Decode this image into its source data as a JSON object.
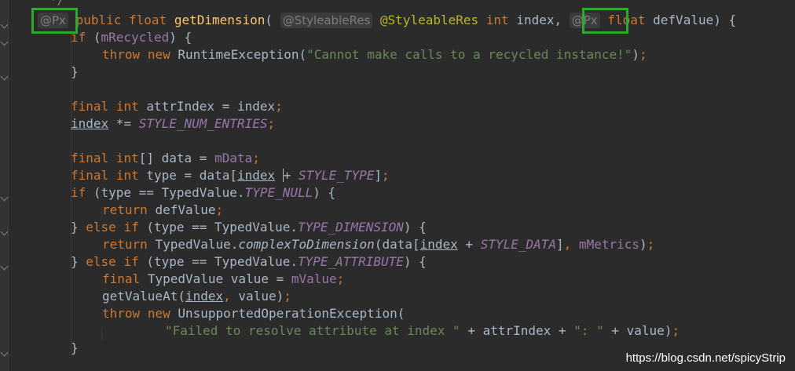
{
  "editor": {
    "comment_end": "*/",
    "hints": {
      "px_hint": "@Px",
      "styleable_hint": "@StyleableRes"
    },
    "tokens": {
      "public": "public",
      "float": "float",
      "int": "int",
      "final": "final",
      "if": "if",
      "throw": "throw",
      "new": "new",
      "return": "return",
      "else": "else",
      "else_if": "} else if (",
      "method_name": "getDimension",
      "styleable_res": "@StyleableRes",
      "param_index": "index",
      "param_defvalue": "defValue",
      "m_recycled": "mRecycled",
      "runtime_exception": "RuntimeException",
      "recycled_msg": "\"Cannot make calls to a recycled instance!\"",
      "attr_index": "attrIndex",
      "style_num_entries": "STYLE_NUM_ENTRIES",
      "data": "data",
      "m_data": "mData",
      "type": "type",
      "style_type": "STYLE_TYPE",
      "typed_value": "TypedValue",
      "type_null": "TYPE_NULL",
      "type_dimension": "TYPE_DIMENSION",
      "complex_to_dimension": "complexToDimension",
      "style_data": "STYLE_DATA",
      "m_metrics": "mMetrics",
      "type_attribute": "TYPE_ATTRIBUTE",
      "value": "value",
      "m_value": "mValue",
      "get_value_at": "getValueAt",
      "unsupported_exception": "UnsupportedOperationException",
      "failed_msg": "\"Failed to resolve attribute at index \"",
      "colon_msg": "\": \""
    }
  },
  "watermark": "https://blog.csdn.net/spicyStrip",
  "colors": {
    "background": "#2b2b2b",
    "keyword": "#cc7832",
    "method": "#ffc66d",
    "string": "#6a8759",
    "field": "#9876aa",
    "annotation": "#bbb529",
    "highlight_box": "#2ea82e"
  }
}
